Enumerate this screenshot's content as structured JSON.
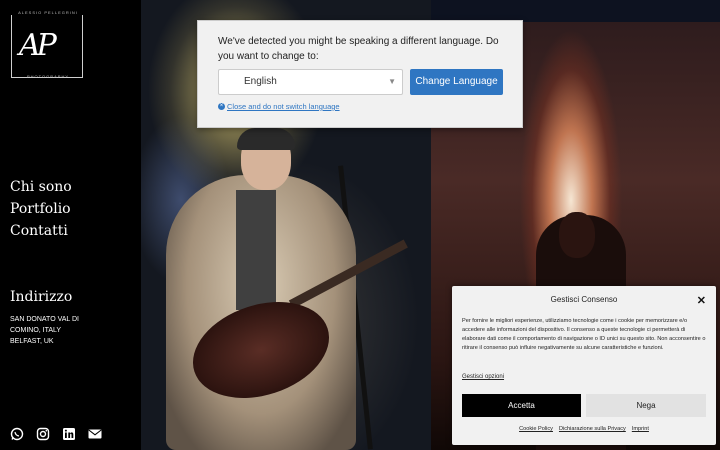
{
  "logo": {
    "top_text": "ALESSIO PELLEGRINI",
    "monogram": "AP",
    "bottom_text": "PHOTOGRAPHY"
  },
  "nav": {
    "items": [
      "Chi sono",
      "Portfolio",
      "Contatti"
    ]
  },
  "address": {
    "title": "Indirizzo",
    "lines": [
      "SAN DONATO VAL DI",
      "COMINO, ITALY",
      "BELFAST, UK"
    ]
  },
  "socials": [
    "whatsapp-icon",
    "instagram-icon",
    "linkedin-icon",
    "email-icon"
  ],
  "language_modal": {
    "message": "We've detected you might be speaking a different language. Do you want to change to:",
    "selected_language": "English",
    "change_button": "Change Language",
    "close_link": "Close and do not switch language"
  },
  "cookie": {
    "title": "Gestisci Consenso",
    "text": "Per fornire le migliori esperienze, utilizziamo tecnologie come i cookie per memorizzare e/o accedere alle informazioni del dispositivo. Il consenso a queste tecnologie ci permetterà di elaborare dati come il comportamento di navigazione o ID unici su questo sito. Non acconsentire o ritirare il consenso può influire negativamente su alcune caratteristiche e funzioni.",
    "options_link": "Gestisci opzioni",
    "accept": "Accetta",
    "deny": "Nega",
    "links": [
      "Cookie Policy",
      "Dichiarazione sulla Privacy",
      "Imprint"
    ]
  },
  "colors": {
    "accent": "#2f76c2",
    "sidebar": "#000000",
    "banner_bg": "#f1f1f1"
  }
}
